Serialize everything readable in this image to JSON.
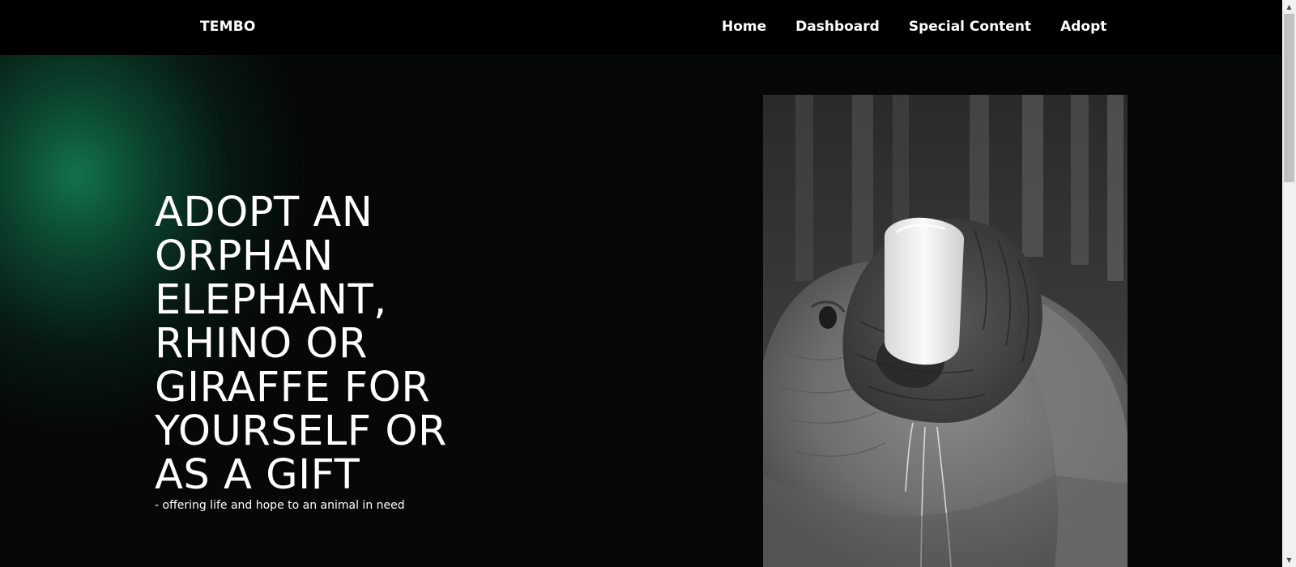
{
  "nav": {
    "logo": "TEMBO",
    "links": [
      {
        "label": "Home"
      },
      {
        "label": "Dashboard"
      },
      {
        "label": "Special Content"
      },
      {
        "label": "Adopt"
      }
    ]
  },
  "hero": {
    "headline": "ADOPT AN\nORPHAN\nELEPHANT,\nRHINO OR\nGIRAFFE FOR\nYOURSELF OR\nAS A GIFT",
    "subline": "- offering life and hope to an animal in need",
    "image_subject": "baby elephant drinking from a milk bottle (black and white photo)"
  },
  "colors": {
    "navbar": "#000000",
    "background": "#060808",
    "glow": "#12784e",
    "text": "#ffffff"
  },
  "scrollbar": {
    "up_icon": "scroll-up-arrow-icon",
    "down_icon": "scroll-down-arrow-icon"
  }
}
